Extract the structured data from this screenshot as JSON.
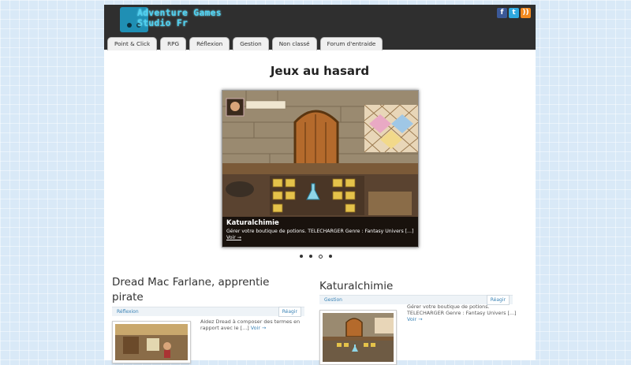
{
  "header": {
    "logo_line1": "Adventure Games",
    "logo_line2": "Studio Fr",
    "social": [
      "facebook-icon",
      "twitter-icon",
      "rss-icon"
    ]
  },
  "nav": {
    "tabs": [
      "Point & Click",
      "RPG",
      "Réflexion",
      "Gestion",
      "Non classé",
      "Forum d'entraide"
    ]
  },
  "main": {
    "title": "Jeux au hasard"
  },
  "slider": {
    "title": "Katuralchimie",
    "text": "Gérer votre boutique de potions. TELECHARGER Genre : Fantasy Univers [...]",
    "link": "Voir →",
    "dots": 4,
    "active_dot": 3
  },
  "posts": [
    {
      "title": "Dread Mac Farlane, apprentie pirate",
      "category": "Réflexion",
      "reply": "Réagir",
      "excerpt": "Aidez Dread à composer des termes en rapport avec le [...]",
      "link": "Voir →"
    },
    {
      "title": "Katuralchimie",
      "category": "Gestion",
      "reply": "Réagir",
      "excerpt": "Gérer votre boutique de potions. TELECHARGER Genre : Fantasy Univers [...]",
      "link": "Voir →"
    }
  ],
  "colors": {
    "header_bg": "#2f2f2f",
    "logo_text": "#4fd0ef",
    "link": "#3a83b6",
    "page_bg": "#d9e9f7"
  }
}
